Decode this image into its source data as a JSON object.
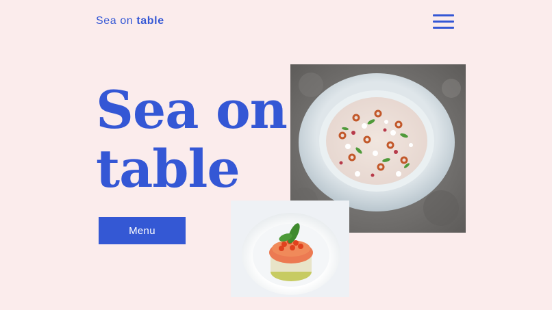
{
  "header": {
    "logo_regular": "Sea on",
    "logo_bold": "table",
    "menu_icon": "hamburger-menu-icon"
  },
  "hero": {
    "title_line1": "Sea on",
    "title_line2": "table",
    "menu_button_label": "Menu"
  },
  "colors": {
    "background": "#fbecec",
    "accent": "#3457d5"
  },
  "images": {
    "large_photo": "carpaccio-plate-photo",
    "small_photo": "tartare-plate-photo"
  }
}
